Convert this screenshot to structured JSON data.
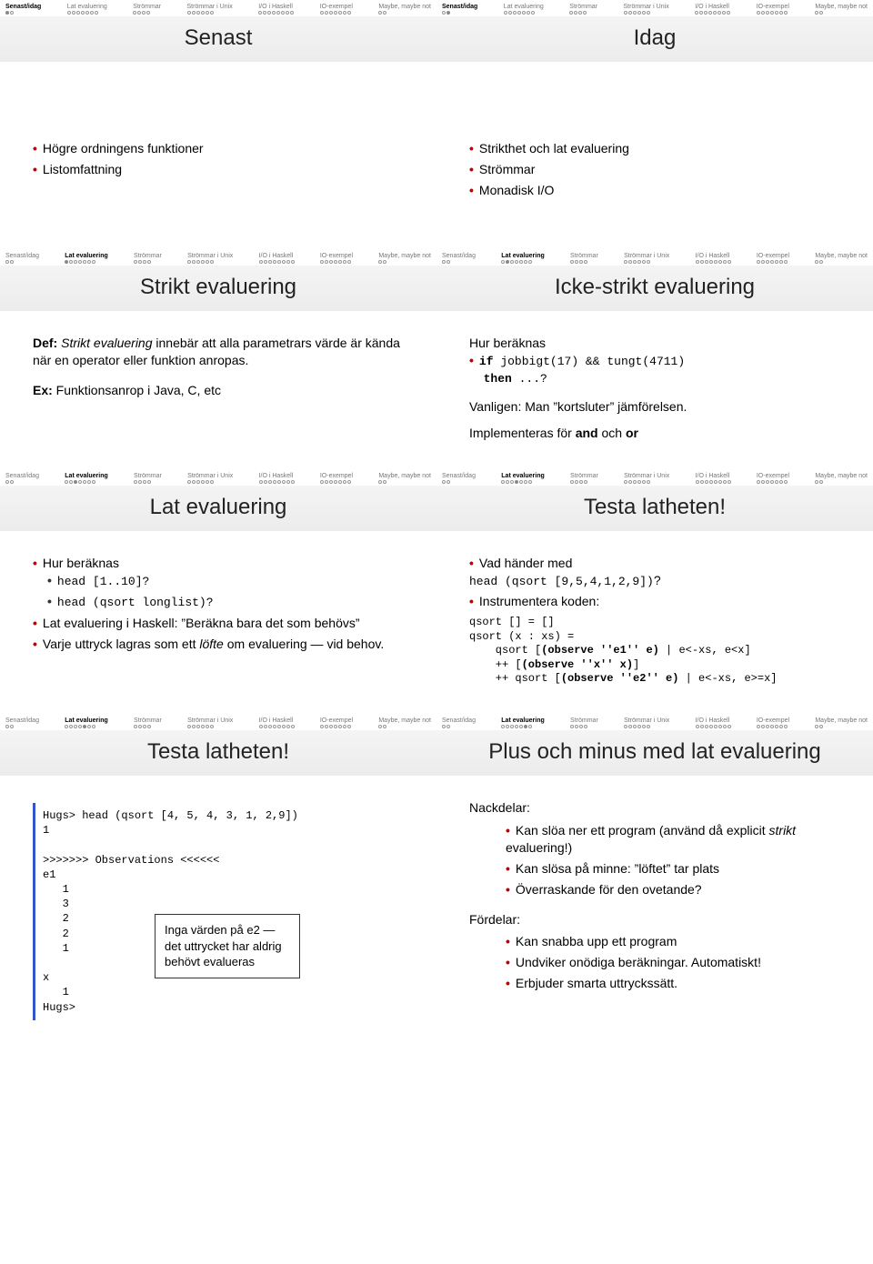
{
  "navSections": [
    {
      "label": "Senast/idag",
      "count": 2
    },
    {
      "label": "Lat evaluering",
      "count": 7
    },
    {
      "label": "Strömmar",
      "count": 4
    },
    {
      "label": "Strömmar i Unix",
      "count": 6
    },
    {
      "label": "I/O i Haskell",
      "count": 8
    },
    {
      "label": "IO-exempel",
      "count": 7
    },
    {
      "label": "Maybe, maybe not",
      "count": 2
    }
  ],
  "slides": [
    {
      "title": "Senast",
      "activeSection": 0,
      "activeDot": 0,
      "bullets": [
        "Högre ordningens funktioner",
        "Listomfattning"
      ],
      "tallBody": true
    },
    {
      "title": "Idag",
      "activeSection": 0,
      "activeDot": 1,
      "bullets": [
        "Strikthet och lat evaluering",
        "Strömmar",
        "Monadisk I/O"
      ],
      "tallBody": true
    },
    {
      "title": "Strikt evaluering",
      "activeSection": 1,
      "activeDot": 0,
      "def": {
        "label": "Def:",
        "text": " Strikt evaluering innebär att alla parametrars värde är kända när en operator eller funktion anropas.",
        "em": "Strikt evaluering"
      },
      "ex": {
        "label": "Ex:",
        "text": " Funktionsanrop i Java, C, etc"
      }
    },
    {
      "title": "Icke-strikt evaluering",
      "activeSection": 1,
      "activeDot": 1,
      "lead": "Hur beräknas",
      "codebullet": {
        "pre": "if",
        "mid": " jobbigt(17) && tungt(4711)",
        "post": "then",
        "tail": " ...?"
      },
      "para1": "Vanligen: Man ”kortsluter” jämförelsen.",
      "para2pre": "Implementeras för ",
      "b1": "and",
      "mid": " och ",
      "b2": "or"
    },
    {
      "title": "Lat evaluering",
      "activeSection": 1,
      "activeDot": 2,
      "bullets_mixed": [
        {
          "text": "Hur beräknas",
          "sub": [
            {
              "code": "head [1..10]?"
            },
            {
              "code": "head (qsort longlist)?"
            }
          ]
        },
        {
          "text": "Lat evaluering i Haskell: ”Beräkna bara det som behövs”"
        },
        {
          "html": "Varje uttryck lagras som ett <span class=\"em\">löfte</span> om evaluering — vid behov."
        }
      ]
    },
    {
      "title": "Testa latheten!",
      "activeSection": 1,
      "activeDot": 3,
      "bullets_mixed": [
        {
          "html": "Vad händer med<br><span class=\"mono\">head (qsort [9,5,4,1,2,9])</span>?"
        },
        {
          "text": "Instrumentera koden:"
        }
      ],
      "code": "qsort [] = []\nqsort (x : xs) =\n    qsort [(observe ''e1'' e) | e<-xs, e<x]\n    ++ [(observe ''x'' x)]\n    ++ qsort [(observe ''e2'' e) | e<-xs, e>=x]"
    },
    {
      "title": "Testa latheten!",
      "activeSection": 1,
      "activeDot": 4,
      "codeblock": "Hugs> head (qsort [4, 5, 4, 3, 1, 2,9])\n1\n\n>>>>>>> Observations <<<<<<\ne1\n   1\n   3\n   2\n   2\n   1\n\nx\n   1\nHugs>",
      "note": "Inga värden på e2 — det uttrycket har aldrig behövt evalueras"
    },
    {
      "title": "Plus och minus med lat evaluering",
      "activeSection": 1,
      "activeDot": 5,
      "nack_label": "Nackdelar:",
      "nack": [
        "Kan slöa ner ett program (använd då explicit <span class=\"em\">strikt</span> evaluering!)",
        "Kan slösa på minne: ”löftet” tar plats",
        "Överraskande för den ovetande?"
      ],
      "ford_label": "Fördelar:",
      "ford": [
        "Kan snabba upp ett program",
        "Undviker onödiga beräkningar. Automatiskt!",
        "Erbjuder smarta uttryckssätt."
      ]
    }
  ]
}
